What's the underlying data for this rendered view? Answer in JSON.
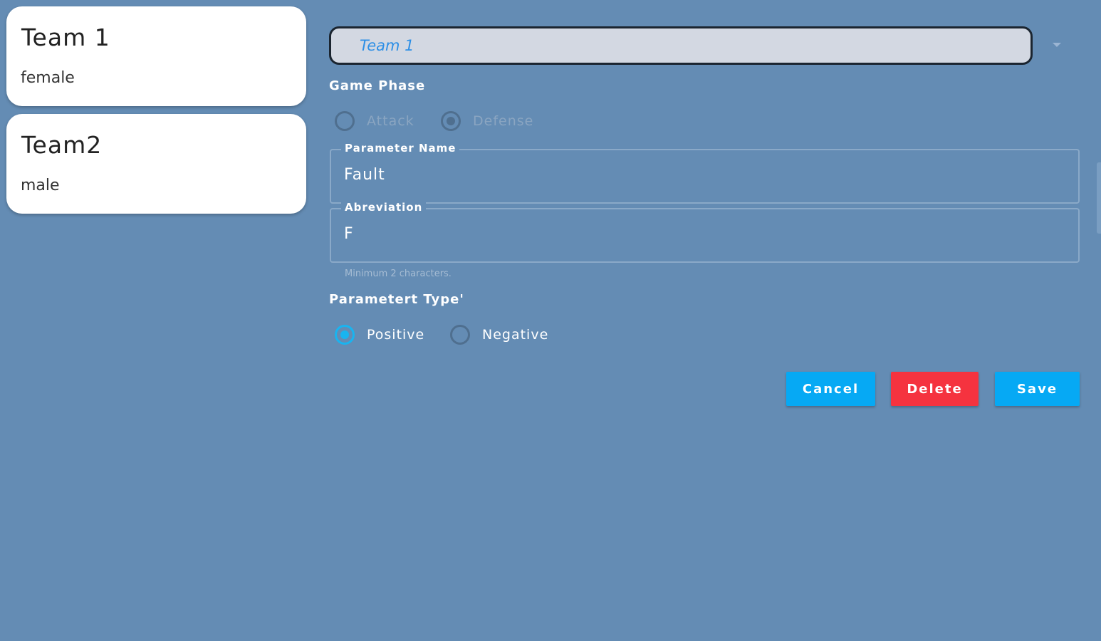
{
  "teams": [
    {
      "name": "Team  1",
      "gender": "female"
    },
    {
      "name": "Team2",
      "gender": "male"
    }
  ],
  "team_select": {
    "value": "Team  1"
  },
  "game_phase": {
    "label": "Game  Phase",
    "options": [
      "Attack",
      "Defense"
    ],
    "selected": "Defense",
    "disabled": true
  },
  "parameter_name": {
    "label": "Parameter  Name",
    "value": "Fault"
  },
  "abbreviation": {
    "label": "Abreviation",
    "value": "F",
    "hint": "Minimum 2 characters."
  },
  "parameter_type": {
    "label": "Parametert  Type'",
    "options": [
      "Positive",
      "Negative"
    ],
    "selected": "Positive"
  },
  "buttons": {
    "cancel": "Cancel",
    "delete": "Delete",
    "save": "Save"
  },
  "colors": {
    "background": "#648cb4",
    "accent": "#06a9f4",
    "danger": "#f5333f",
    "card": "#ffffff"
  }
}
